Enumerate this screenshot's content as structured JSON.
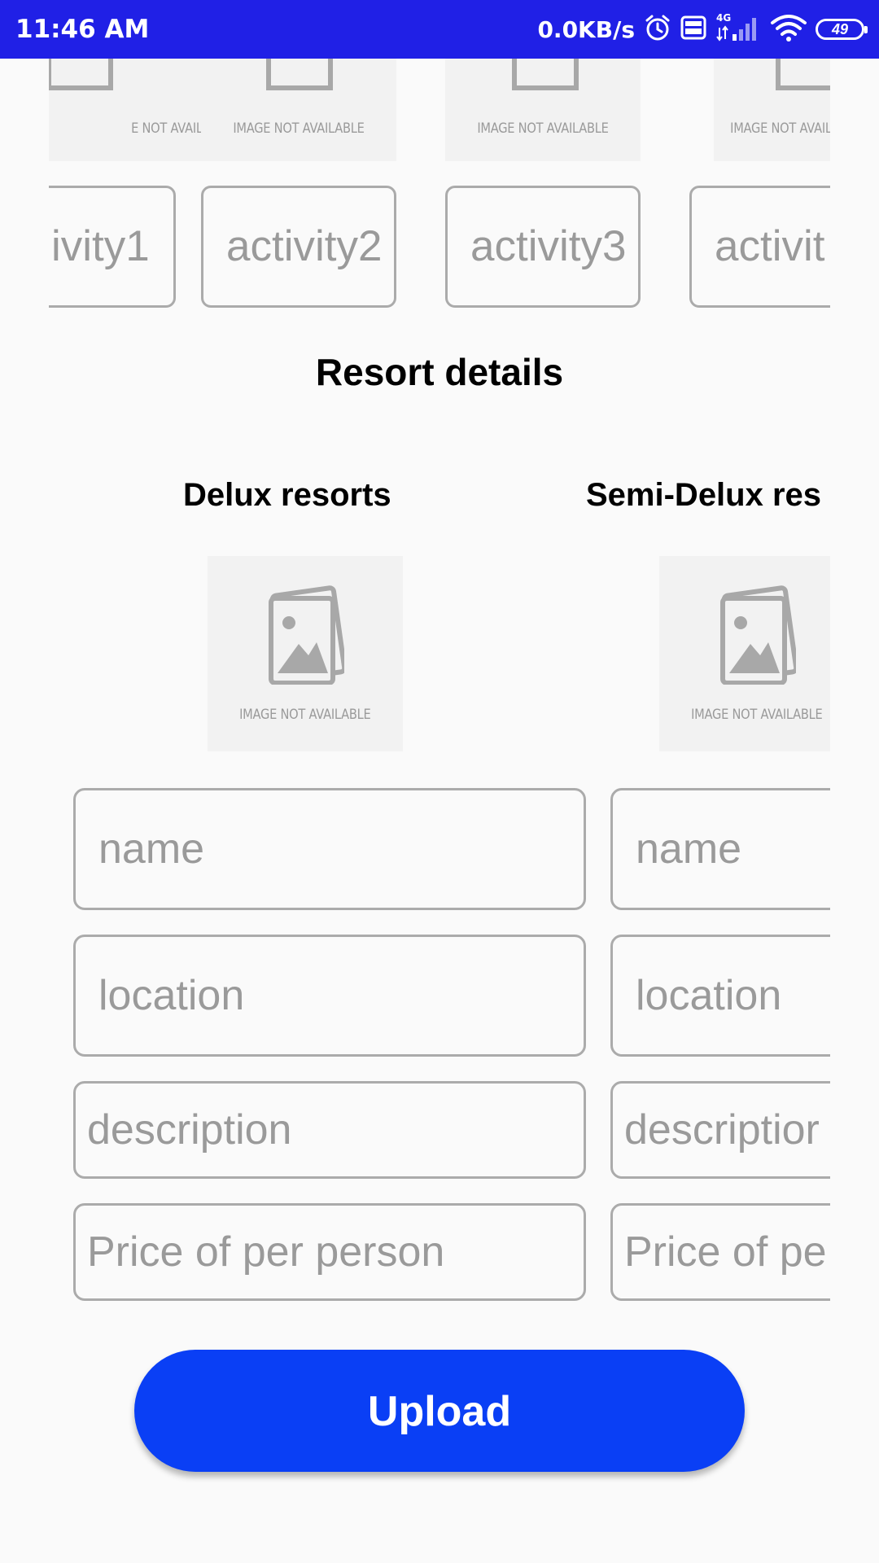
{
  "status_bar": {
    "time": "11:46 AM",
    "net_speed": "0.0KB/s",
    "battery": "49",
    "icons": [
      "alarm-icon",
      "volte-icon",
      "4g-signal-icon",
      "wifi-icon",
      "battery-icon"
    ],
    "color": "#2020e6"
  },
  "top_images": {
    "label": "IMAGE NOT AVAILABLE",
    "label_partial_first": "E NOT AVAILABLE",
    "label_partial_last": "IMAGE NOT AVAIL"
  },
  "activities": [
    "ivity1",
    "activity2",
    "activity3",
    "activit"
  ],
  "resort_section": {
    "title": "Resort details",
    "columns": [
      {
        "title": "Delux resorts",
        "image_label": "IMAGE NOT AVAILABLE",
        "fields": {
          "name": "name",
          "location": "location",
          "description": "description",
          "price": "Price of per person"
        }
      },
      {
        "title": "Semi-Delux res",
        "image_label": "IMAGE NOT AVAILABLE",
        "fields": {
          "name": "name",
          "location": "location",
          "description": "descriptior",
          "price": "Price of pe"
        }
      }
    ]
  },
  "upload_button": {
    "label": "Upload",
    "color": "#0a3ff5"
  }
}
